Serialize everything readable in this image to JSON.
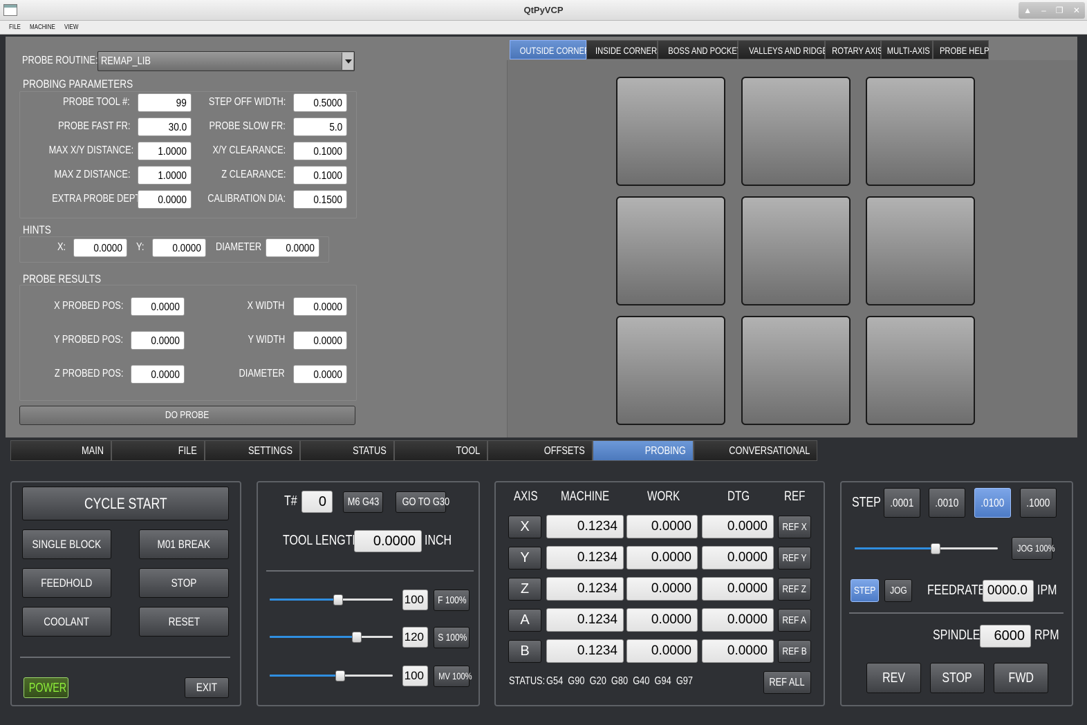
{
  "window": {
    "title": "QtPyVCP"
  },
  "menu": [
    "FILE",
    "MACHINE",
    "VIEW"
  ],
  "probe": {
    "routine_label": "PROBE ROUTINE:",
    "routine_value": "REMAP_LIB",
    "params_title": "PROBING PARAMETERS",
    "params": [
      {
        "label": "PROBE TOOL #:",
        "value": "99"
      },
      {
        "label": "STEP OFF WIDTH:",
        "value": "0.5000"
      },
      {
        "label": "PROBE FAST FR:",
        "value": "30.0"
      },
      {
        "label": "PROBE SLOW FR:",
        "value": "5.0"
      },
      {
        "label": "MAX X/Y DISTANCE:",
        "value": "1.0000"
      },
      {
        "label": "X/Y CLEARANCE:",
        "value": "0.1000"
      },
      {
        "label": "MAX Z DISTANCE:",
        "value": "1.0000"
      },
      {
        "label": "Z CLEARANCE:",
        "value": "0.1000"
      },
      {
        "label": "EXTRA PROBE DEPTH:",
        "value": "0.0000"
      },
      {
        "label": "CALIBRATION DIA:",
        "value": "0.1500"
      }
    ],
    "hints_title": "HINTS",
    "hints": [
      {
        "label": "X:",
        "value": "0.0000"
      },
      {
        "label": "Y:",
        "value": "0.0000"
      },
      {
        "label": "DIAMETER",
        "value": "0.0000"
      }
    ],
    "results_title": "PROBE RESULTS",
    "results": [
      {
        "label": "X PROBED POS:",
        "value": "0.0000"
      },
      {
        "label": "X WIDTH",
        "value": "0.0000"
      },
      {
        "label": "Y PROBED POS:",
        "value": "0.0000"
      },
      {
        "label": "Y WIDTH",
        "value": "0.0000"
      },
      {
        "label": "Z PROBED POS:",
        "value": "0.0000"
      },
      {
        "label": "DIAMETER",
        "value": "0.0000"
      }
    ],
    "do_probe": "DO PROBE",
    "tabs": [
      "OUTSIDE CORNERS",
      "INSIDE CORNERS",
      "BOSS AND POCKETS",
      "VALLEYS AND RIDGES",
      "ROTARY AXIS",
      "MULTI-AXIS",
      "PROBE HELP"
    ],
    "active_tab": "OUTSIDE CORNERS"
  },
  "main_tabs": [
    "MAIN",
    "FILE",
    "SETTINGS",
    "STATUS",
    "TOOL",
    "OFFSETS",
    "PROBING",
    "CONVERSATIONAL"
  ],
  "active_main_tab": "PROBING",
  "controls": {
    "cycle_start": "CYCLE START",
    "single_block": "SINGLE BLOCK",
    "m01_break": "M01 BREAK",
    "feedhold": "FEEDHOLD",
    "stop": "STOP",
    "coolant": "COOLANT",
    "reset": "RESET",
    "power": "POWER",
    "exit": "EXIT"
  },
  "tool": {
    "tnum_label": "T#",
    "tnum": "0",
    "m6g43": "M6 G43",
    "goto_g30": "GO TO G30",
    "length_label": "TOOL LENGTH",
    "length": "0.0000",
    "length_unit": "INCH",
    "overrides": [
      {
        "value": "100",
        "button": "F 100%",
        "level": 0.55
      },
      {
        "value": "120",
        "button": "S 100%",
        "level": 0.7
      },
      {
        "value": "100",
        "button": "MV 100%",
        "level": 0.57
      }
    ]
  },
  "dro": {
    "headers": [
      "AXIS",
      "MACHINE",
      "WORK",
      "DTG",
      "REF"
    ],
    "rows": [
      {
        "axis": "X",
        "machine": "0.1234",
        "work": "0.0000",
        "dtg": "0.0000",
        "ref": "REF X"
      },
      {
        "axis": "Y",
        "machine": "0.1234",
        "work": "0.0000",
        "dtg": "0.0000",
        "ref": "REF Y"
      },
      {
        "axis": "Z",
        "machine": "0.1234",
        "work": "0.0000",
        "dtg": "0.0000",
        "ref": "REF Z"
      },
      {
        "axis": "A",
        "machine": "0.1234",
        "work": "0.0000",
        "dtg": "0.0000",
        "ref": "REF A"
      },
      {
        "axis": "B",
        "machine": "0.1234",
        "work": "0.0000",
        "dtg": "0.0000",
        "ref": "REF B"
      }
    ],
    "status_label": "STATUS:",
    "status_codes": "G54  G90  G20  G80  G40  G94  G97",
    "ref_all": "REF ALL"
  },
  "jog": {
    "step_label": "STEP",
    "steps": [
      ".0001",
      ".0010",
      ".0100",
      ".1000"
    ],
    "selected_step": ".0100",
    "jog_button": "JOG 100%",
    "jog_level": 0.56,
    "mode_step": "STEP",
    "mode_jog": "JOG",
    "feedrate_label": "FEEDRATE",
    "feedrate": "0000.0",
    "feedrate_unit": "IPM",
    "spindle_label": "SPINDLE",
    "spindle": "6000",
    "spindle_unit": "RPM",
    "rev": "REV",
    "stop": "STOP",
    "fwd": "FWD"
  }
}
